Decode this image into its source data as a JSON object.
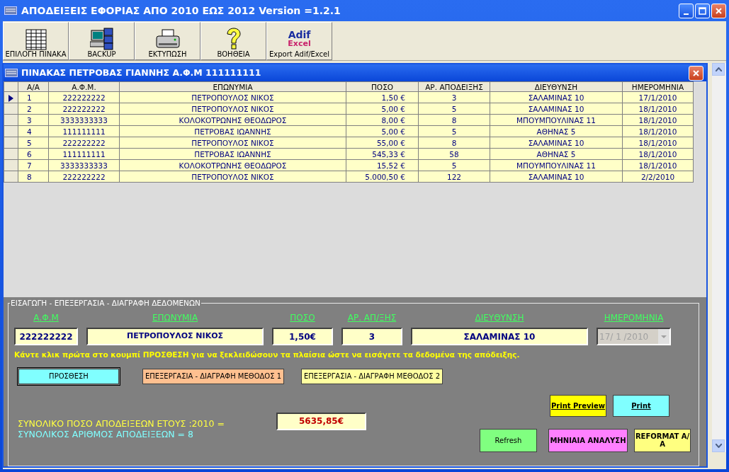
{
  "window": {
    "title": "ΑΠΟΔΕΙΞΕΙΣ ΕΦΟΡΙΑΣ ΑΠΟ 2010 ΕΩΣ 2012  Version =1.2.1"
  },
  "toolbar": [
    {
      "label": "ΕΠΙΛΟΓΗ ΠΙΝΑΚΑ",
      "kind": "table"
    },
    {
      "label": "BACKUP",
      "kind": "backup"
    },
    {
      "label": "ΕΚΤΥΠΩΣΗ",
      "kind": "printer"
    },
    {
      "label": "ΒΟΗΘΕΙΑ",
      "kind": "help"
    },
    {
      "label": "Export Adif/Excel",
      "kind": "logo",
      "logo_lines": [
        "Adif",
        "Excel"
      ]
    }
  ],
  "child_window": {
    "title": "ΠΙΝΑΚΑΣ ΠΕΤΡΟΒΑΣ ΓΙΑΝΝΗΣ Α.Φ.Μ 111111111"
  },
  "table": {
    "columns": [
      "Α/Α",
      "Α.Φ.Μ.",
      "ΕΠΩΝΥΜΙΑ",
      "ΠΟΣΟ",
      "ΑΡ. ΑΠΟΔΕΙΞΗΣ",
      "ΔΙΕΥΘΥΝΣΗ",
      "ΗΜΕΡΟΜΗΝΙΑ"
    ],
    "rows": [
      {
        "selected": true,
        "cells": [
          "1",
          "222222222",
          "ΠΕΤΡΟΠΟΥΛΟΣ ΝΙΚΟΣ",
          "1,50 €",
          "3",
          "ΣΑΛΑΜΙΝΑΣ 10",
          "17/1/2010"
        ]
      },
      {
        "selected": false,
        "cells": [
          "2",
          "222222222",
          "ΠΕΤΡΟΠΟΥΛΟΣ ΝΙΚΟΣ",
          "5,00 €",
          "5",
          "ΣΑΛΑΜΙΝΑΣ 10",
          "18/1/2010"
        ]
      },
      {
        "selected": false,
        "cells": [
          "3",
          "3333333333",
          "ΚΟΛΟΚΟΤΡΩΝΗΣ ΘΕΟΔΩΡΟΣ",
          "8,00 €",
          "8",
          "ΜΠΟΥΜΠΟΥΛΙΝΑΣ 11",
          "18/1/2010"
        ]
      },
      {
        "selected": false,
        "cells": [
          "4",
          "111111111",
          "ΠΕΤΡΟΒΑΣ ΙΩΑΝΝΗΣ",
          "5,00 €",
          "5",
          "ΑΘΗΝΑΣ 5",
          "18/1/2010"
        ]
      },
      {
        "selected": false,
        "cells": [
          "5",
          "222222222",
          "ΠΕΤΡΟΠΟΥΛΟΣ ΝΙΚΟΣ",
          "55,00 €",
          "8",
          "ΣΑΛΑΜΙΝΑΣ 10",
          "18/1/2010"
        ]
      },
      {
        "selected": false,
        "cells": [
          "6",
          "111111111",
          "ΠΕΤΡΟΒΑΣ ΙΩΑΝΝΗΣ",
          "545,33 €",
          "58",
          "ΑΘΗΝΑΣ 5",
          "18/1/2010"
        ]
      },
      {
        "selected": false,
        "cells": [
          "7",
          "3333333333",
          "ΚΟΛΟΚΟΤΡΩΝΗΣ ΘΕΟΔΩΡΟΣ",
          "15,52 €",
          "5",
          "ΜΠΟΥΜΠΟΥΛΙΝΑΣ 11",
          "18/1/2010"
        ]
      },
      {
        "selected": false,
        "cells": [
          "8",
          "222222222",
          "ΠΕΤΡΟΠΟΥΛΟΣ ΝΙΚΟΣ",
          "5.000,50 €",
          "122",
          "ΣΑΛΑΜΙΝΑΣ 10",
          "2/2/2010"
        ]
      }
    ]
  },
  "form": {
    "legend": "ΕΙΣΑΓΩΓΗ - ΕΠΕΞΕΡΓΑΣΙΑ - ΔΙΑΓΡΑΦΗ ΔΕΔΟΜΕΝΩΝ",
    "fields": [
      {
        "label": "Α.Φ.Μ",
        "value": "222222222",
        "kind": "text",
        "disabled": false
      },
      {
        "label": "ΕΠΩΝΥΜΙΑ",
        "value": "ΠΕΤΡΟΠΟΥΛΟΣ ΝΙΚΟΣ",
        "kind": "text",
        "disabled": false
      },
      {
        "label": "ΠΟΣΟ",
        "value": "1,50€",
        "kind": "text",
        "disabled": false
      },
      {
        "label": "ΑΡ. ΑΠ/ΞΗΣ",
        "value": "3",
        "kind": "text",
        "disabled": false
      },
      {
        "label": "ΔΙΕΥΘΥΝΣΗ",
        "value": "ΣΑΛΑΜΙΝΑΣ 10",
        "kind": "text",
        "disabled": false
      },
      {
        "label": "ΗΜΕΡΟΜΗΝΙΑ",
        "value": "17/ 1 /2010",
        "kind": "date",
        "disabled": true
      }
    ],
    "hint": "Κάντε κλικ πρώτα στο κουμπί ΠΡΟΣΘΕΣΗ για να ξεκλειδώσουν τα πλαίσια ώστε να εισάγετε τα δεδομένα της απόδειξης.",
    "actions": [
      {
        "label": "ΠΡΟΣΘΕΣΗ",
        "color": "#80ffff"
      },
      {
        "label": "ΕΠΕΞΕΡΓΑΣΙΑ - ΔΙΑΓΡΑΦΗ ΜΕΘΟΔΟΣ 1",
        "color": "#ffc090"
      },
      {
        "label": "ΕΠΕΞΕΡΓΑΣΙΑ - ΔΙΑΓΡΑΦΗ ΜΕΘΟΔΟΣ 2",
        "color": "#ffffa0"
      }
    ],
    "total_label": "ΣΥΝΟΛΙΚΟ ΠΟΣΟ ΑΠΟΔΕΙΞΕΩΝ ΕΤΟΥΣ :2010 =",
    "count_label": "ΣΥΝΟΛΙΚΟΣ ΑΡΙΘΜΟΣ ΑΠΟΔΕΙΞΕΩΝ = 8",
    "total_value": "5635,85€",
    "print_buttons": [
      {
        "label": "Print Preview",
        "color": "#ffff00"
      },
      {
        "label": "Print",
        "color": "#80ffff"
      }
    ],
    "bottom_buttons": [
      {
        "label": "Refresh",
        "color": "#80ff80"
      },
      {
        "label": "ΜΗΝΙΑΙΑ ΑΝΑΛΥΣΗ",
        "color": "#ff80ff"
      },
      {
        "label": "REFORMAT Α/Α",
        "color": "#ffff80"
      }
    ]
  }
}
